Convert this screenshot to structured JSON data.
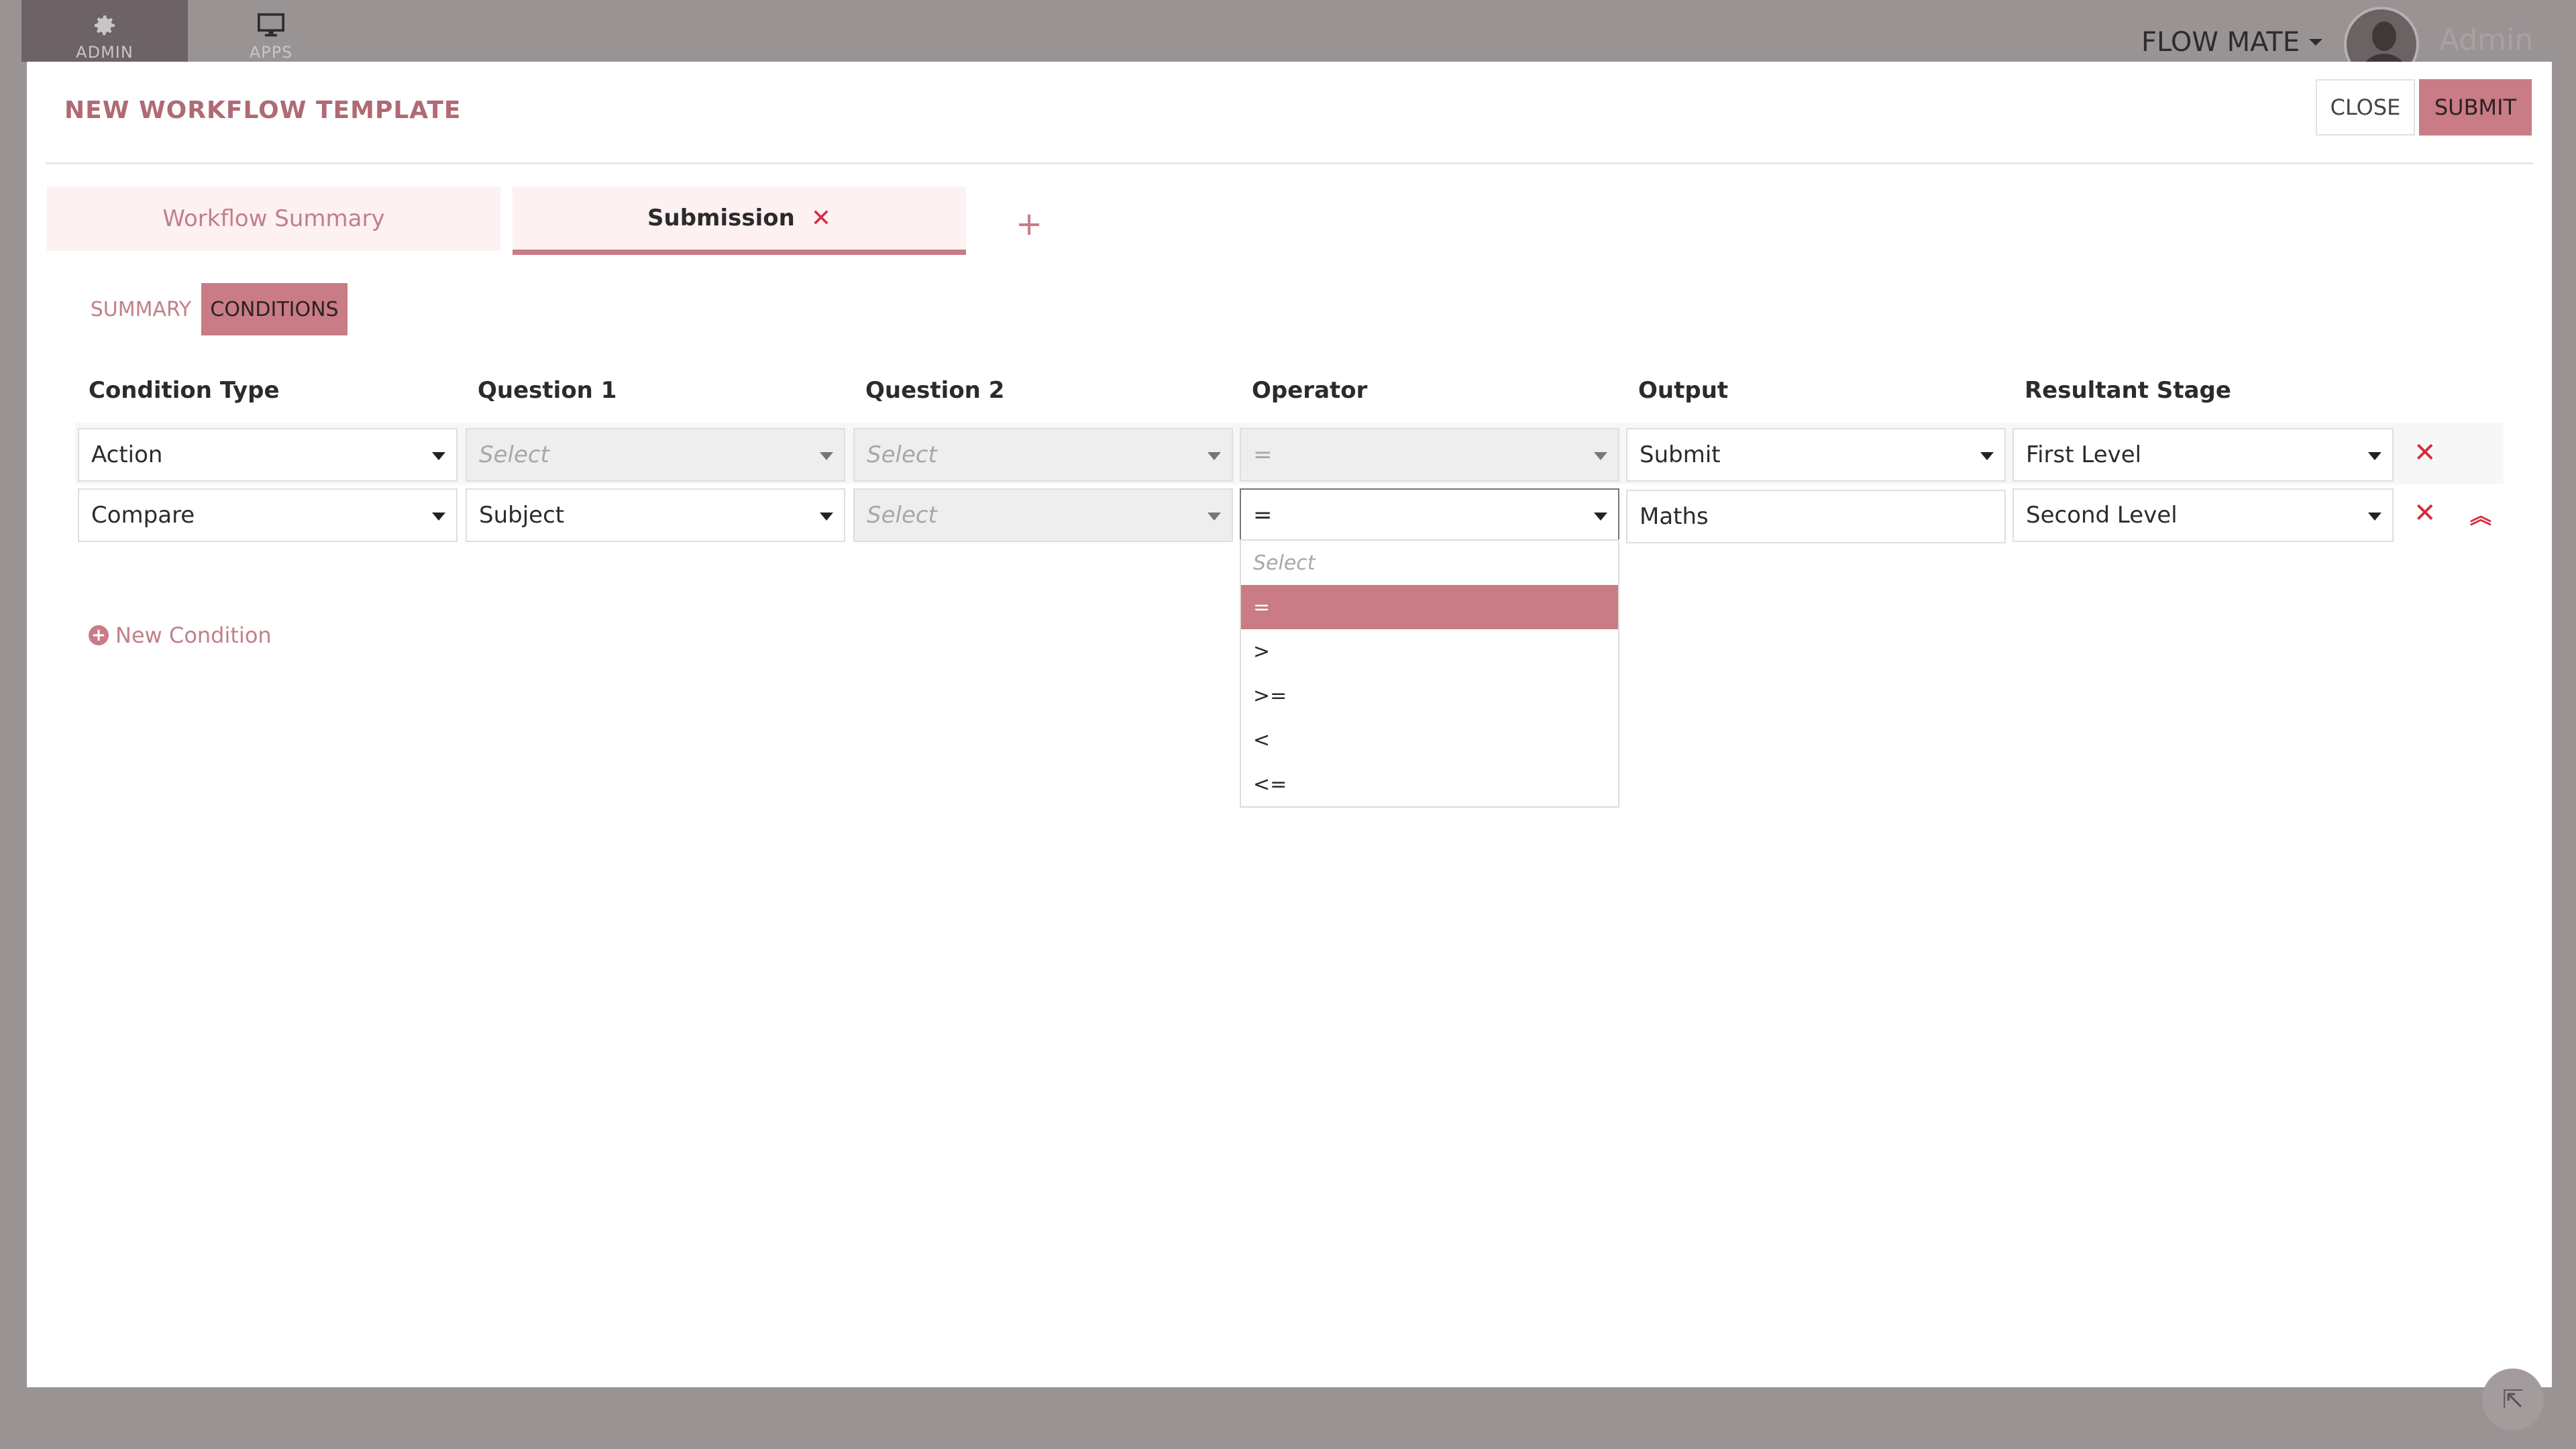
{
  "topbar": {
    "admin_label": "ADMIN",
    "apps_label": "APPS",
    "brand": "FLOW MATE",
    "username": "Admin"
  },
  "modal": {
    "title": "NEW WORKFLOW TEMPLATE",
    "close_label": "CLOSE",
    "submit_label": "SUBMIT"
  },
  "tabs": [
    {
      "label": "Workflow Summary"
    },
    {
      "label": "Submission"
    }
  ],
  "add_tab_label": "+",
  "subtabs": {
    "summary": "SUMMARY",
    "conditions": "CONDITIONS"
  },
  "columns": [
    "Condition Type",
    "Question 1",
    "Question 2",
    "Operator",
    "Output",
    "Resultant Stage"
  ],
  "rows": [
    {
      "condition_type": "Action",
      "question1": "Select",
      "question2": "Select",
      "operator": "=",
      "output": "Submit",
      "stage": "First Level"
    },
    {
      "condition_type": "Compare",
      "question1": "Subject",
      "question2": "Select",
      "operator": "=",
      "output": "Maths",
      "stage": "Second Level"
    }
  ],
  "new_condition_label": "New Condition",
  "operator_options": [
    "Select",
    "=",
    ">",
    ">=",
    "<",
    "<="
  ],
  "colors": {
    "accent": "#c97b86",
    "delete": "#d62b3f",
    "backdrop": "#9a9394"
  }
}
